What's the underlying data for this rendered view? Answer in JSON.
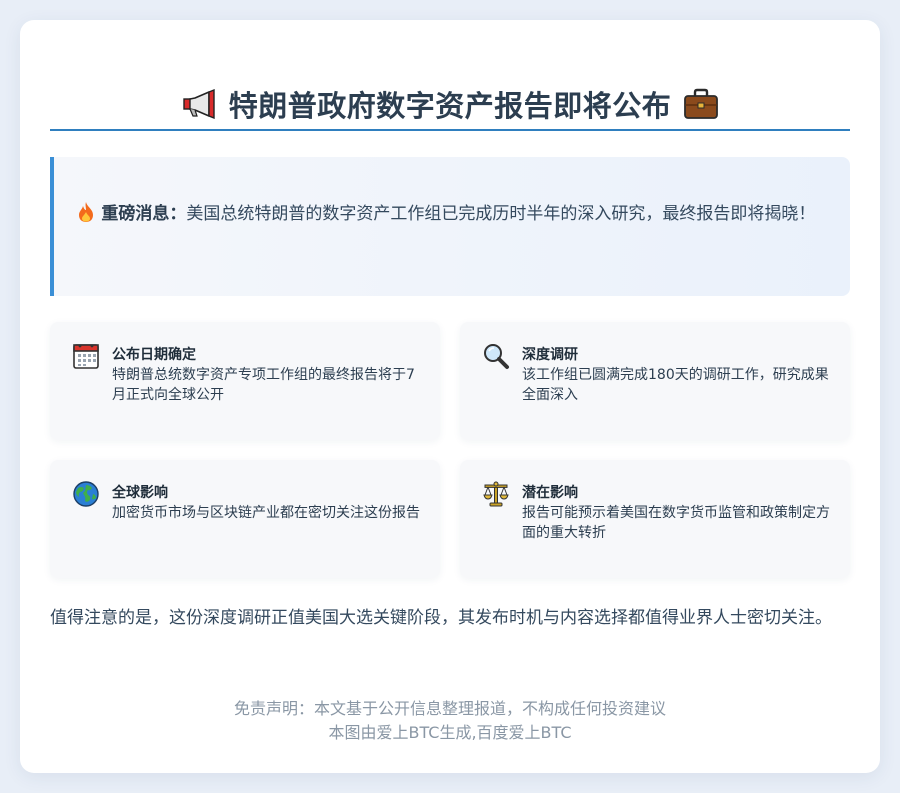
{
  "header": {
    "icon_left": "megaphone-icon",
    "title": "特朗普政府数字资产报告即将公布",
    "icon_right": "briefcase-icon"
  },
  "alert": {
    "icon": "fire-icon",
    "label": "重磅消息：",
    "text": "美国总统特朗普的数字资产工作组已完成历时半年的深入研究，最终报告即将揭晓！"
  },
  "cards": [
    {
      "icon": "calendar-icon",
      "title": "公布日期确定",
      "desc": "特朗普总统数字资产专项工作组的最终报告将于7月正式向全球公开"
    },
    {
      "icon": "magnifier-icon",
      "title": "深度调研",
      "desc": "该工作组已圆满完成180天的调研工作，研究成果全面深入"
    },
    {
      "icon": "globe-icon",
      "title": "全球影响",
      "desc": "加密货币市场与区块链产业都在密切关注这份报告"
    },
    {
      "icon": "scales-icon",
      "title": "潜在影响",
      "desc": "报告可能预示着美国在数字货币监管和政策制定方面的重大转折"
    }
  ],
  "note": "值得注意的是，这份深度调研正值美国大选关键阶段，其发布时机与内容选择都值得业界人士密切关注。",
  "footer": {
    "disclaimer": "免责声明：本文基于公开信息整理报道，不构成任何投资建议",
    "credit": "本图由爱上BTC生成,百度爱上BTC"
  },
  "colors": {
    "accent": "#2f7fbf",
    "alert_border": "#3a8fd6",
    "text": "#2c3e50",
    "muted": "#8a97a5"
  }
}
